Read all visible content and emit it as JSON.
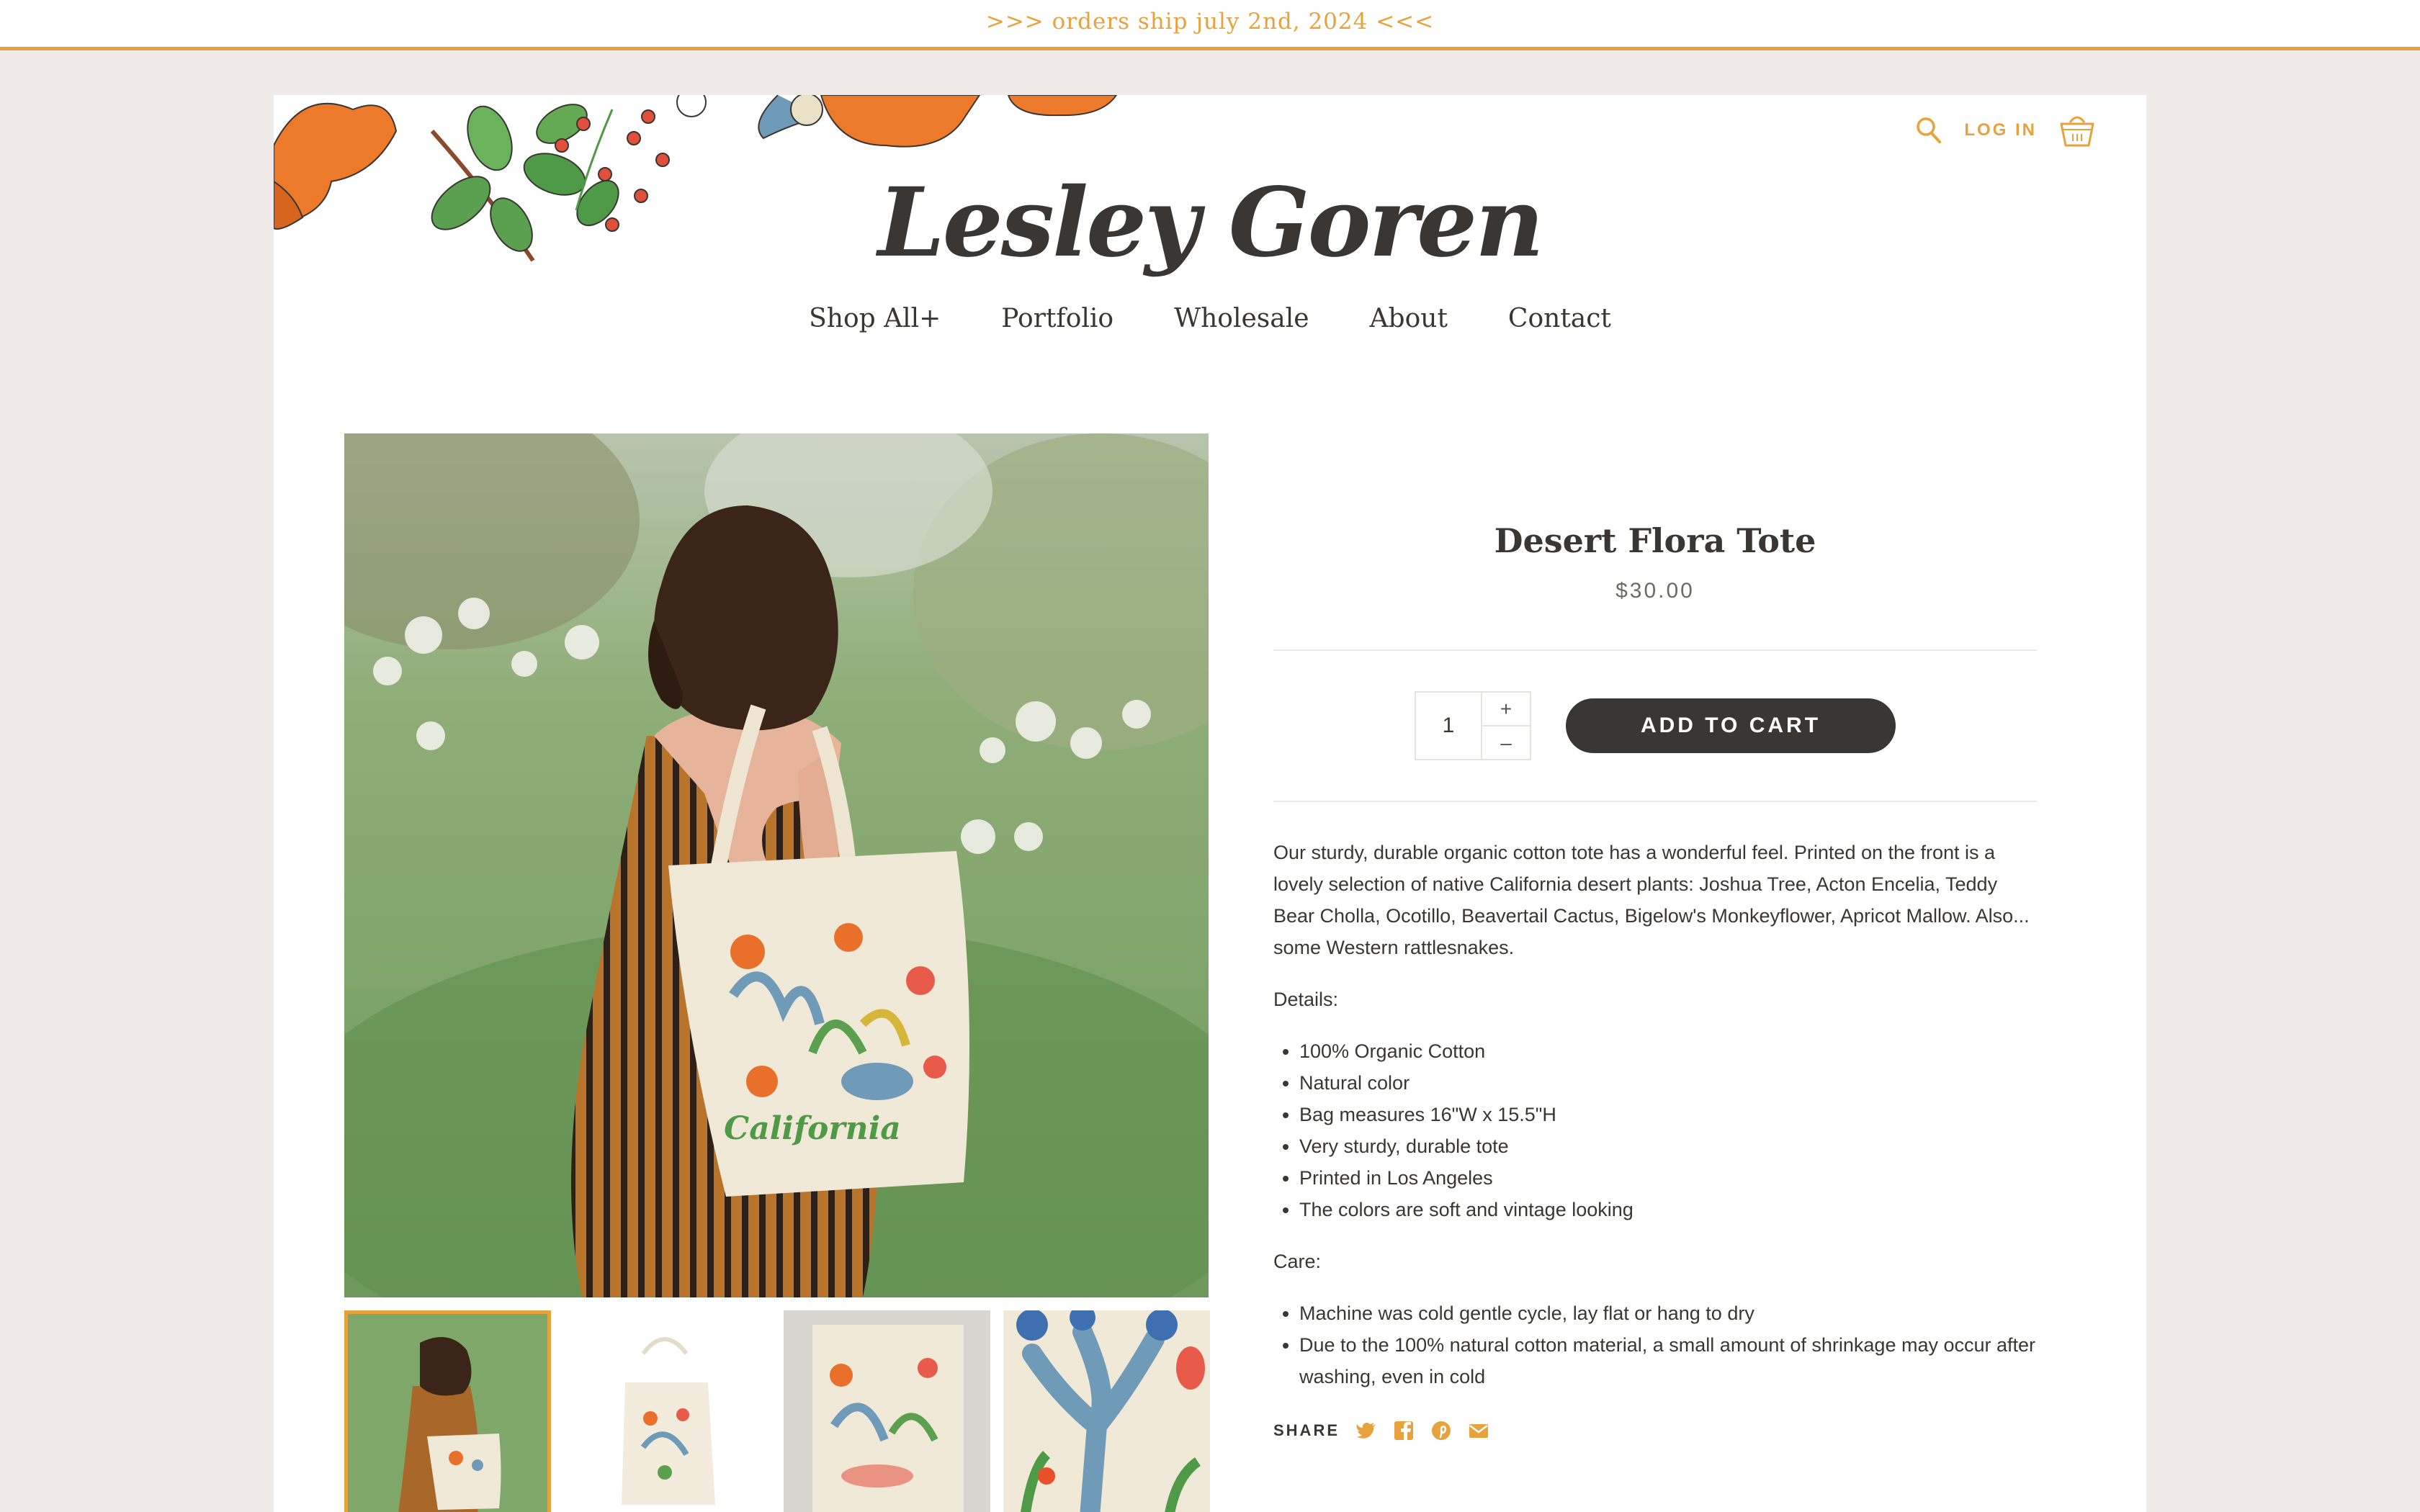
{
  "announcement": ">>> orders ship july 2nd, 2024 <<<",
  "header": {
    "logo": "Lesley Goren",
    "login": "LOG IN",
    "search_icon": "search-icon",
    "cart_icon": "basket-icon"
  },
  "nav": {
    "items": [
      {
        "label": "Shop All+"
      },
      {
        "label": "Portfolio"
      },
      {
        "label": "Wholesale"
      },
      {
        "label": "About"
      },
      {
        "label": "Contact"
      }
    ]
  },
  "product": {
    "title": "Desert Flora Tote",
    "price": "$30.00",
    "quantity": "1",
    "qty_plus": "+",
    "qty_minus": "–",
    "add_to_cart": "ADD TO CART",
    "description": "Our sturdy, durable organic cotton tote has a wonderful feel. Printed on the front is a lovely selection of native California desert plants: Joshua Tree, Acton Encelia, Teddy Bear Cholla, Ocotillo, Beavertail Cactus, Bigelow's Monkeyflower, Apricot Mallow. Also... some Western rattlesnakes.",
    "details_heading": "Details:",
    "details": [
      "100% Organic Cotton",
      "Natural color",
      "Bag measures 16\"W x 15.5\"H",
      "Very sturdy, durable tote",
      "Printed in Los Angeles",
      "The colors are soft and vintage looking"
    ],
    "care_heading": "Care:",
    "care": [
      "Machine was cold gentle cycle, lay flat or hang to dry",
      "Due to the 100% natural cotton material, a small amount of shrinkage may occur after washing, even in cold"
    ],
    "share_label": "SHARE",
    "print_text": "California"
  },
  "colors": {
    "accent": "#e8a23d",
    "dark": "#3a3633",
    "background": "#f0ebe8"
  }
}
